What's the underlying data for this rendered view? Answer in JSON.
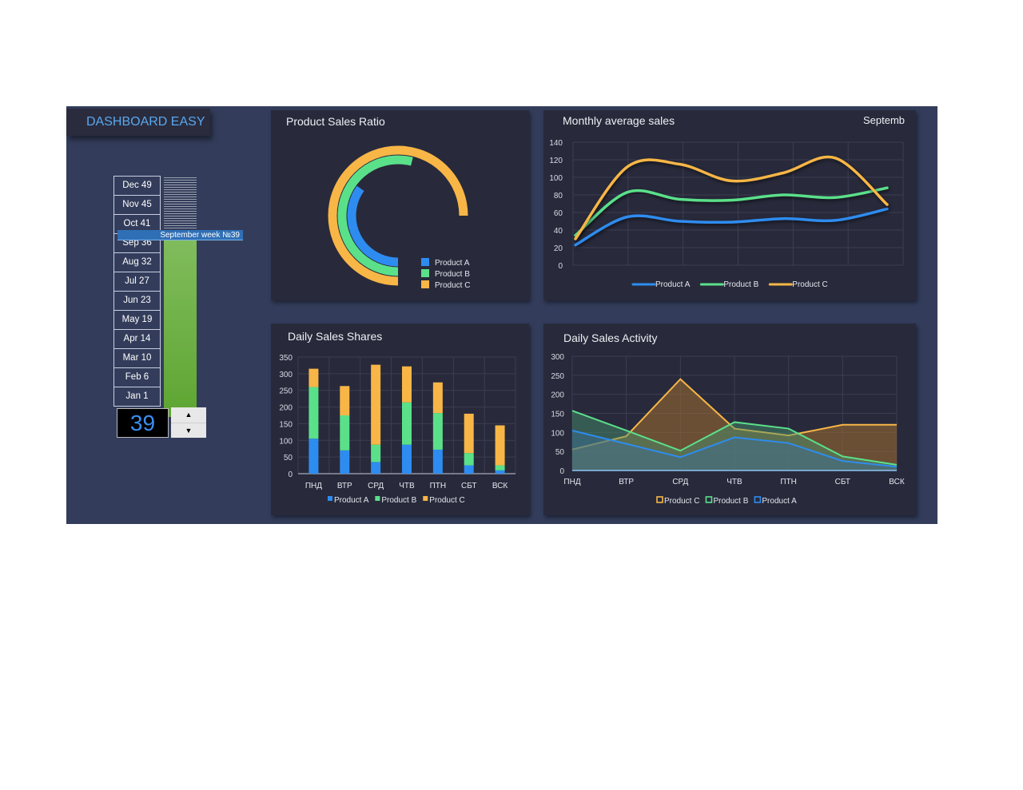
{
  "app_title": "DASHBOARD EASY",
  "week_selector": {
    "weeks": [
      "Dec 49",
      "Nov 45",
      "Oct 41",
      "Sep 36",
      "Aug 32",
      "Jul 27",
      "Jun 23",
      "May 19",
      "Apr 14",
      "Mar 10",
      "Feb 6",
      "Jan 1"
    ],
    "current_label": "September week №39",
    "value": "39",
    "progress_week": 39,
    "max_week": 52,
    "up_icon": "triangle-up-icon",
    "down_icon": "triangle-down-icon"
  },
  "colors": {
    "product_a": "#2e8cf0",
    "product_b": "#5be08a",
    "product_c": "#f8b646",
    "panel": "#282a3b",
    "background": "#333d5b"
  },
  "chart_data": [
    {
      "id": "ratio",
      "type": "pie",
      "title": "Product Sales Ratio",
      "style": "radial-bar",
      "series": [
        {
          "name": "Product A",
          "percent": 35
        },
        {
          "name": "Product B",
          "percent": 54
        },
        {
          "name": "Product C",
          "percent": 75
        }
      ],
      "legend": "bottom-right"
    },
    {
      "id": "monthly",
      "type": "line",
      "title": "Monthly average sales",
      "subtitle": "Septemb",
      "yticks": [
        "0",
        "20",
        "40",
        "60",
        "80",
        "100",
        "120",
        "140"
      ],
      "ylim": [
        0,
        140
      ],
      "grid": true,
      "series": [
        {
          "name": "Product A",
          "values": [
            23,
            55,
            50,
            49,
            53,
            51,
            64
          ]
        },
        {
          "name": "Product B",
          "values": [
            34,
            83,
            75,
            74,
            80,
            77,
            88
          ]
        },
        {
          "name": "Product C",
          "values": [
            30,
            112,
            115,
            96,
            105,
            122,
            69
          ]
        }
      ],
      "legend": "bottom"
    },
    {
      "id": "shares",
      "type": "bar",
      "stacked": true,
      "title": "Daily Sales Shares",
      "categories": [
        "ПНД",
        "ВТР",
        "СРД",
        "ЧТВ",
        "ПТН",
        "СБТ",
        "ВСК"
      ],
      "yticks": [
        "0",
        "50",
        "100",
        "150",
        "200",
        "250",
        "300",
        "350"
      ],
      "ylim": [
        0,
        350
      ],
      "grid": true,
      "series": [
        {
          "name": "Product A",
          "values": [
            105,
            70,
            35,
            87,
            72,
            25,
            10
          ]
        },
        {
          "name": "Product B",
          "values": [
            155,
            105,
            52,
            127,
            110,
            37,
            15
          ]
        },
        {
          "name": "Product C",
          "values": [
            55,
            88,
            240,
            108,
            92,
            118,
            120
          ]
        }
      ],
      "legend": "bottom"
    },
    {
      "id": "activity",
      "type": "area",
      "title": "Daily Sales Activity",
      "categories": [
        "ПНД",
        "ВТР",
        "СРД",
        "ЧТВ",
        "ПТН",
        "СБТ",
        "ВСК"
      ],
      "yticks": [
        "0",
        "50",
        "100",
        "150",
        "200",
        "250",
        "300"
      ],
      "ylim": [
        0,
        300
      ],
      "grid": true,
      "series": [
        {
          "name": "Product C",
          "values": [
            55,
            90,
            240,
            110,
            92,
            120,
            120
          ]
        },
        {
          "name": "Product B",
          "values": [
            157,
            105,
            52,
            127,
            110,
            37,
            15
          ]
        },
        {
          "name": "Product A",
          "values": [
            105,
            70,
            35,
            87,
            72,
            25,
            10
          ]
        }
      ],
      "legend": "bottom"
    }
  ]
}
